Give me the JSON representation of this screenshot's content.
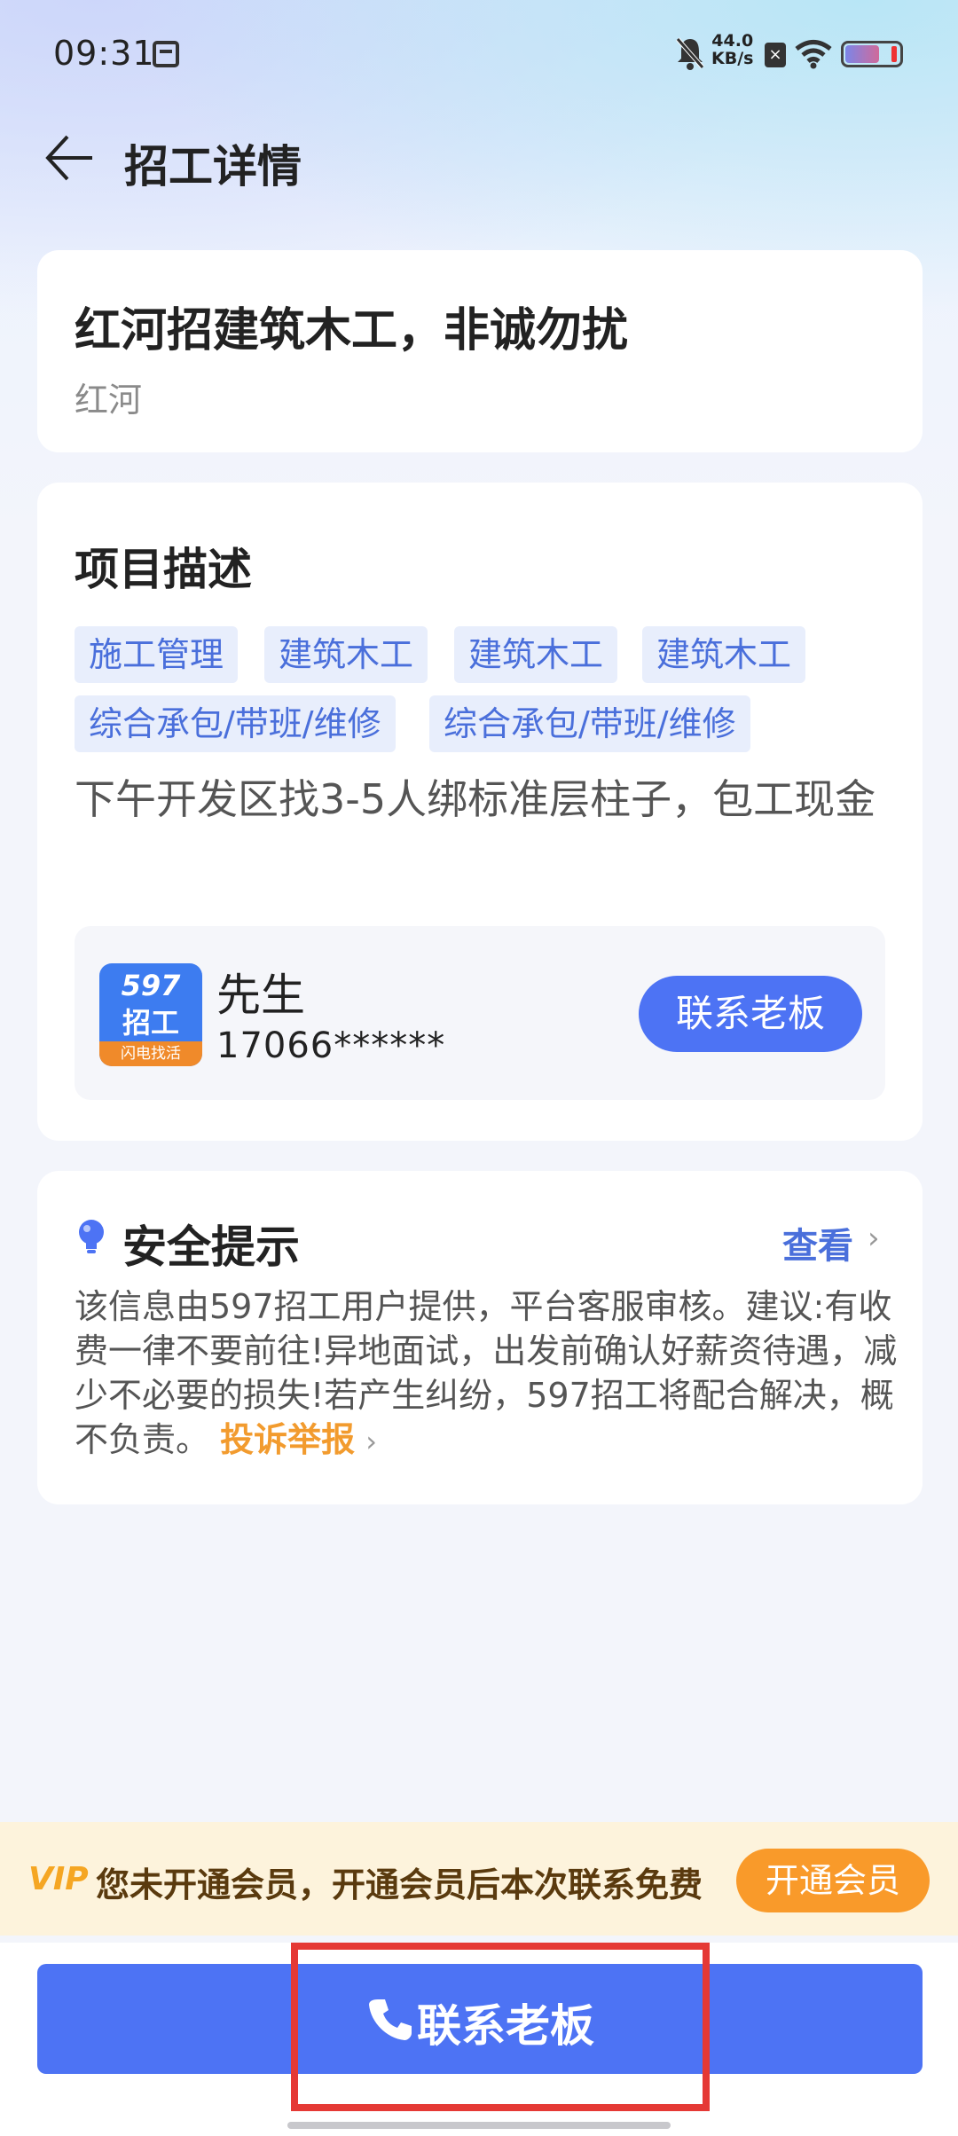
{
  "status_bar": {
    "time": "09:31",
    "net_speed_value": "44.0",
    "net_speed_unit": "KB/s"
  },
  "header": {
    "title": "招工详情"
  },
  "job": {
    "title": "红河招建筑木工，非诚勿扰",
    "location": "红河"
  },
  "project": {
    "section_title": "项目描述",
    "tags": [
      "施工管理",
      "建筑木工",
      "建筑木工",
      "建筑木工",
      "综合承包/带班/维修",
      "综合承包/带班/维修"
    ],
    "description": "下午开发区找3-5人绑标准层柱子，包工现金"
  },
  "contact": {
    "logo_line1": "597",
    "logo_line2": "招工",
    "logo_line3": "闪电找活",
    "name": "先生",
    "phone": "17066******",
    "button_label": "联系老板"
  },
  "safety": {
    "section_title": "安全提示",
    "view_label": "查看",
    "body": "该信息由597招工用户提供，平台客服审核。建议:有收费一律不要前往!异地面试，出发前确认好薪资待遇，减少不必要的损失!若产生纠纷，597招工将配合解决，概不负责。",
    "complain_label": "投诉举报"
  },
  "vip": {
    "badge": "VIP",
    "message": "您未开通会员，开通会员后本次联系免费",
    "button_label": "开通会员"
  },
  "bottom": {
    "call_label": "联系老板"
  },
  "colors": {
    "primary": "#4d73f4",
    "accent_orange": "#f99a2a",
    "highlight_red": "#e53935"
  }
}
